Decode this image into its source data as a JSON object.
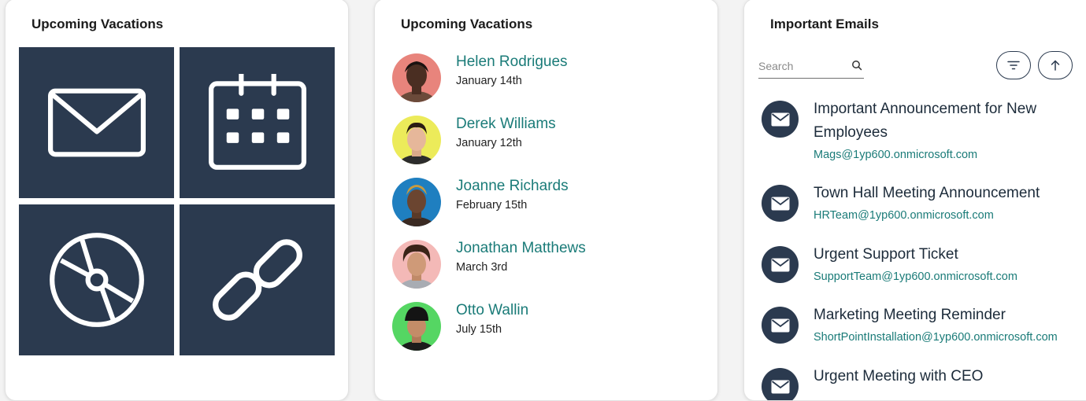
{
  "card_tiles": {
    "title": "Upcoming Vacations",
    "tiles": [
      {
        "icon": "envelope-icon"
      },
      {
        "icon": "calendar-icon"
      },
      {
        "icon": "disc-icon"
      },
      {
        "icon": "link-icon"
      }
    ]
  },
  "card_people": {
    "title": "Upcoming Vacations",
    "people": [
      {
        "name": "Helen Rodrigues",
        "date": "January 14th",
        "avatar_bg": "#e8847c"
      },
      {
        "name": "Derek Williams",
        "date": "January 12th",
        "avatar_bg": "#eceb5a"
      },
      {
        "name": "Joanne Richards",
        "date": "February 15th",
        "avatar_bg": "#1f7fc0"
      },
      {
        "name": "Jonathan Matthews",
        "date": "March 3rd",
        "avatar_bg": "#f4b9b7"
      },
      {
        "name": "Otto Wallin",
        "date": "July 15th",
        "avatar_bg": "#55d663"
      }
    ]
  },
  "card_emails": {
    "title": "Important Emails",
    "search_placeholder": "Search",
    "emails": [
      {
        "subject": "Important Announcement for New Employees",
        "sender": "Mags@1yp600.onmicrosoft.com"
      },
      {
        "subject": "Town Hall Meeting Announcement",
        "sender": "HRTeam@1yp600.onmicrosoft.com"
      },
      {
        "subject": "Urgent Support Ticket",
        "sender": "SupportTeam@1yp600.onmicrosoft.com"
      },
      {
        "subject": "Marketing Meeting Reminder",
        "sender": "ShortPointInstallation@1yp600.onmicrosoft.com"
      },
      {
        "subject": "Urgent Meeting with CEO",
        "sender": ""
      }
    ]
  },
  "colors": {
    "tile_bg": "#2b3a4f",
    "accent_teal": "#1a7b78",
    "text_dark": "#1c2b3a"
  }
}
